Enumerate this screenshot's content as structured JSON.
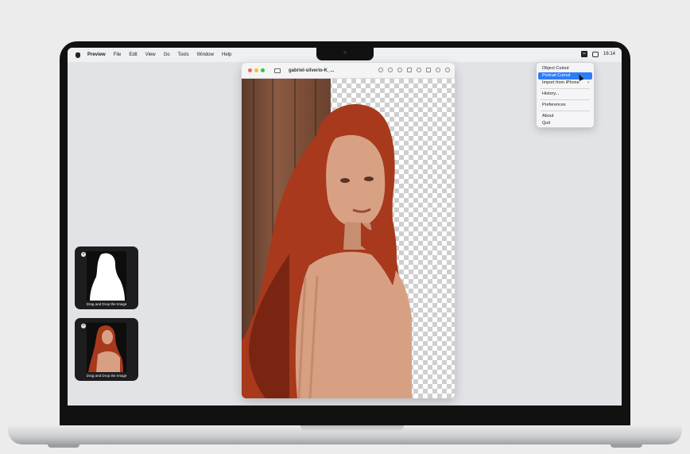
{
  "menubar": {
    "app_name": "Preview",
    "items": [
      "File",
      "Edit",
      "View",
      "Go",
      "Tools",
      "Window",
      "Help"
    ],
    "status_icon": "cutout-app-icon",
    "time": "16:14"
  },
  "dropdown": {
    "items": [
      {
        "label": "Object Cutout"
      },
      {
        "label": "Portrait Cutout",
        "active": true
      },
      {
        "label": "Import from iPhone",
        "submenu": true
      },
      {
        "label": "History..."
      },
      {
        "label": "Preferences"
      },
      {
        "label": "About"
      },
      {
        "label": "Quit"
      }
    ]
  },
  "window": {
    "title": "gabriel-silverio-K_..."
  },
  "thumbnails": [
    {
      "caption": "Drag and Drop the Image",
      "kind": "mask"
    },
    {
      "caption": "Drag and Drop the Image",
      "kind": "photo"
    }
  ],
  "colors": {
    "accent": "#2e7cf6",
    "hair": "#a8391c"
  }
}
